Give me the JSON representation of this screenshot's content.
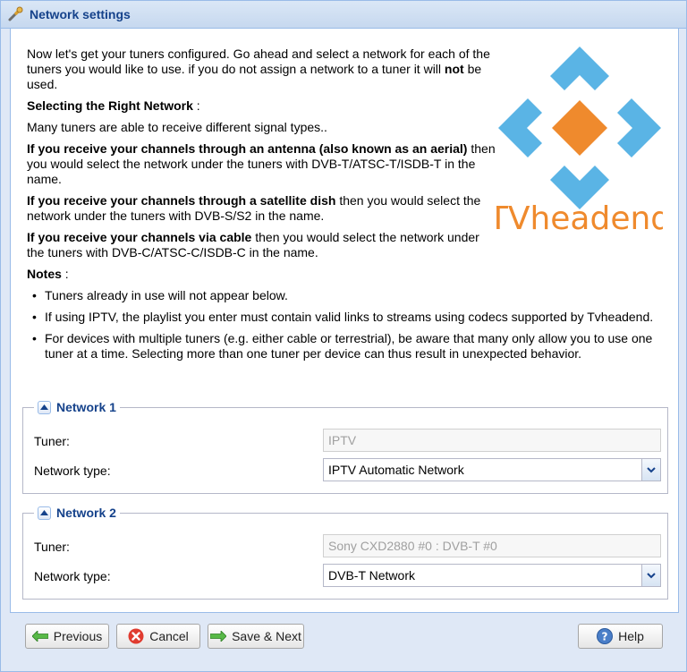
{
  "window": {
    "title": "Network settings"
  },
  "intro": {
    "p1": "Now let's get your tuners configured. Go ahead and select a network for each of the tuners you would like to use. if you do not assign a network to a tuner it will ",
    "p1_bold": "not",
    "p1_end": " be used.",
    "heading": "Selecting the Right Network",
    "heading_suffix": " :",
    "many": "Many tuners are able to receive different signal types..",
    "antenna_bold": "If you receive your channels through an antenna (also known as an aerial)",
    "antenna_rest": " then you would select the network under the tuners with DVB-T/ATSC-T/ISDB-T in the name.",
    "sat_bold": "If you receive your channels through a satellite dish",
    "sat_rest": " then you would select the network under the tuners with DVB-S/S2 in the name.",
    "cable_bold": "If you receive your channels via cable",
    "cable_rest": " then you would select the network under the tuners with DVB-C/ATSC-C/ISDB-C in the name.",
    "notes_heading": "Notes",
    "notes_suffix": " :"
  },
  "notes": [
    "Tuners already in use will not appear below.",
    "If using IPTV, the playlist you enter must contain valid links to streams using codecs supported by Tvheadend.",
    "For devices with multiple tuners (e.g. either cable or terrestrial), be aware that many only allow you to use one tuner at a time. Selecting more than one tuner per device can thus result in unexpected behavior."
  ],
  "logo": {
    "text": "TVheadend"
  },
  "network1": {
    "legend": "Network 1",
    "tuner_label": "Tuner:",
    "tuner_value": "IPTV",
    "type_label": "Network type:",
    "type_value": "IPTV Automatic Network"
  },
  "network2": {
    "legend": "Network 2",
    "tuner_label": "Tuner:",
    "tuner_value": "Sony CXD2880 #0 : DVB-T #0",
    "type_label": "Network type:",
    "type_value": "DVB-T Network"
  },
  "buttons": {
    "previous": "Previous",
    "cancel": "Cancel",
    "save_next": "Save & Next",
    "help": "Help"
  },
  "colors": {
    "logo_blue": "#5ab4e5",
    "logo_orange": "#ef8a2d",
    "title_blue": "#15428b"
  }
}
